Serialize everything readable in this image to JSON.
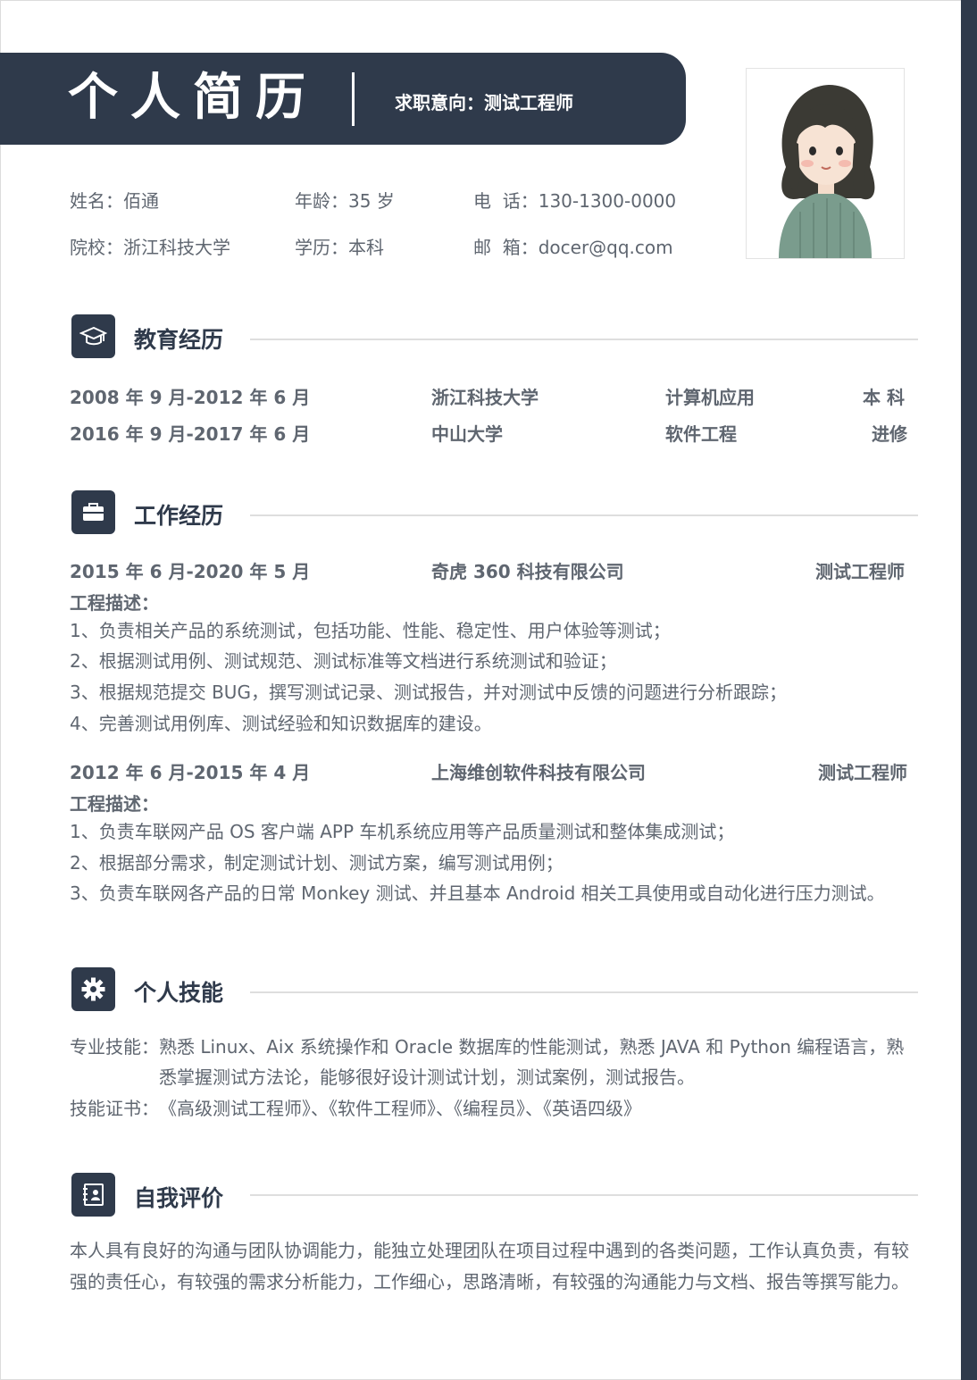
{
  "header": {
    "title": "个人简历",
    "job_intent": "求职意向：测试工程师"
  },
  "basic_info": {
    "name": "姓名：佰通",
    "age": "年龄：35 岁",
    "phone": "电  话：130-1300-0000",
    "school": "院校：浙江科技大学",
    "degree": "学历：本科",
    "email": "邮  箱：docer@qq.com"
  },
  "education": {
    "title": "教育经历",
    "icon": "graduation-cap-icon",
    "rows": [
      {
        "period": "2008 年 9 月-2012 年 6 月",
        "school": "浙江科技大学",
        "major": "计算机应用",
        "degree": "本 科"
      },
      {
        "period": "2016 年 9 月-2017 年 6 月",
        "school": "中山大学",
        "major": "软件工程",
        "degree": "进修"
      }
    ]
  },
  "work": {
    "title": "工作经历",
    "icon": "briefcase-icon",
    "jobs": [
      {
        "period": "2015 年 6 月-2020 年 5 月",
        "company": "奇虎 360 科技有限公司",
        "position": "测试工程师",
        "desc_label": "工程描述：",
        "items": [
          "1、负责相关产品的系统测试，包括功能、性能、稳定性、用户体验等测试；",
          "2、根据测试用例、测试规范、测试标准等文档进行系统测试和验证；",
          "3、根据规范提交 BUG，撰写测试记录、测试报告，并对测试中反馈的问题进行分析跟踪；",
          "4、完善测试用例库、测试经验和知识数据库的建设。"
        ]
      },
      {
        "period": "2012 年 6 月-2015 年 4 月",
        "company": "上海维创软件科技有限公司",
        "position": "测试工程师",
        "desc_label": "工程描述：",
        "items": [
          "1、负责车联网产品 OS 客户端 APP 车机系统应用等产品质量测试和整体集成测试；",
          "2、根据部分需求，制定测试计划、测试方案，编写测试用例；",
          "3、负责车联网各产品的日常 Monkey 测试、并且基本 Android 相关工具使用或自动化进行压力测试。"
        ]
      }
    ]
  },
  "skills": {
    "title": "个人技能",
    "icon": "gear-icon",
    "pro_label": "专业技能：",
    "pro_line1": "熟悉 Linux、Aix 系统操作和 Oracle 数据库的性能测试，熟悉 JAVA 和 Python 编程语言，熟",
    "pro_line2": "悉掌握测试方法论，能够很好设计测试计划，测试案例，测试报告。",
    "cert_label": "技能证书：",
    "cert_value": "《高级测试工程师》、《软件工程师》、《编程员》、《英语四级》"
  },
  "self_eval": {
    "title": "自我评价",
    "icon": "notebook-icon",
    "text": "本人具有良好的沟通与团队协调能力，能独立处理团队在项目过程中遇到的各类问题，工作认真负责，有较强的责任心，有较强的需求分析能力，工作细心，思路清晰，有较强的沟通能力与文档、报告等撰写能力。"
  },
  "colors": {
    "primary": "#2f3a4b",
    "text": "#5f6670",
    "line": "#dedede"
  }
}
